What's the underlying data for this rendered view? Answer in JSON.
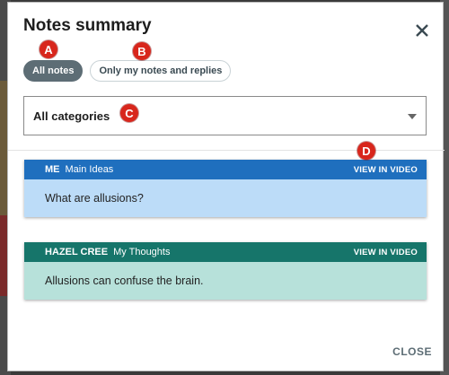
{
  "modal": {
    "title": "Notes summary",
    "close_label": "CLOSE"
  },
  "filters": [
    {
      "label": "All notes",
      "active": true
    },
    {
      "label": "Only my notes and replies",
      "active": false
    }
  ],
  "category_select": {
    "value": "All categories"
  },
  "notes": [
    {
      "author": "ME",
      "category": "Main Ideas",
      "link": "VIEW IN VIDEO",
      "text": "What are allusions?",
      "header_color": "#1f6fbe",
      "body_color": "#bcdcf8"
    },
    {
      "author": "HAZEL CREE",
      "category": "My Thoughts",
      "link": "VIEW IN VIDEO",
      "text": "Allusions can confuse the brain.",
      "header_color": "#16756a",
      "body_color": "#b7e1da"
    }
  ],
  "markers": [
    "A",
    "B",
    "C",
    "D"
  ]
}
